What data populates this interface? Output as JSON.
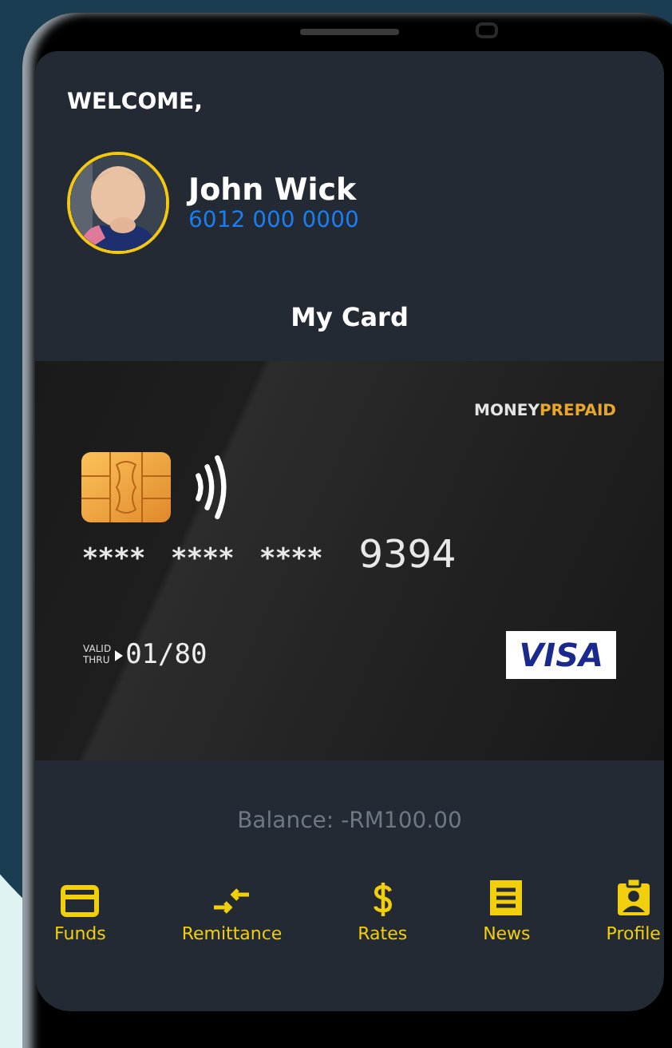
{
  "greeting": "WELCOME,",
  "user": {
    "name": "John Wick",
    "phone": "6012 000 0000"
  },
  "section_title": "My Card",
  "card": {
    "brand": {
      "first": "MONEY",
      "second": "PREPAID"
    },
    "number": [
      "****",
      "****",
      "****",
      "9394"
    ],
    "valid_label": [
      "VALID",
      "THRU"
    ],
    "expiry": "01/80",
    "network": "VISA"
  },
  "balance": "Balance: -RM100.00",
  "tabs": [
    {
      "kind": "card",
      "label": "Funds"
    },
    {
      "kind": "transfer",
      "label": "Remittance"
    },
    {
      "kind": "dollar",
      "label": "Rates"
    },
    {
      "kind": "news",
      "label": "News"
    },
    {
      "kind": "badge",
      "label": "Profile"
    }
  ]
}
